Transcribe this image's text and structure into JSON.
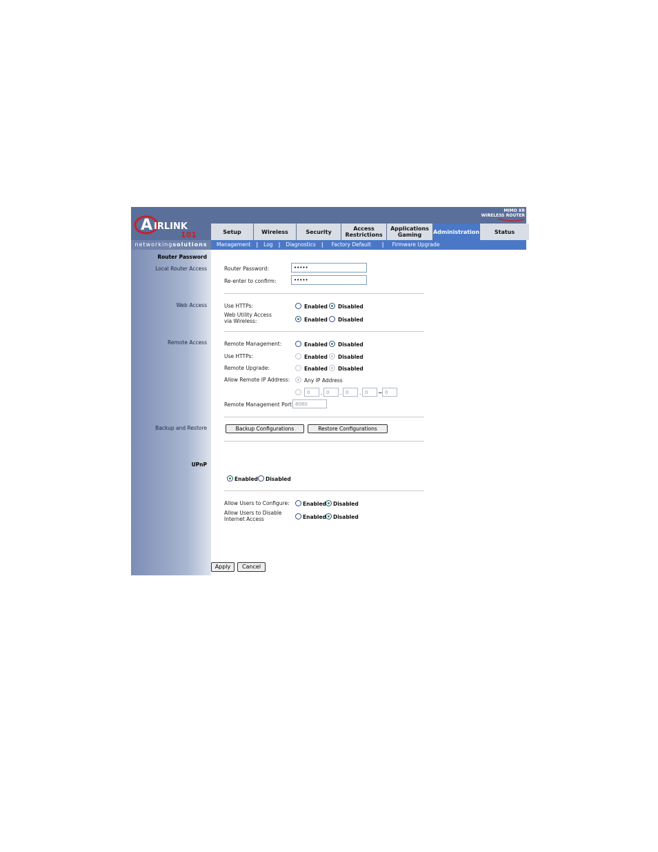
{
  "brand": {
    "logo_text": "AIRLINK 101",
    "tagline_a": "networking",
    "tagline_b": "solutions",
    "product_line1": "MIMO XR",
    "product_line2": "WIRELESS ROUTER"
  },
  "tabs": [
    {
      "label": "Setup"
    },
    {
      "label": "Wireless"
    },
    {
      "label": "Security"
    },
    {
      "label": "Access Restrictions"
    },
    {
      "label": "Applications Gaming"
    },
    {
      "label": "Administration"
    },
    {
      "label": "Status"
    }
  ],
  "subnav": [
    "Management",
    "Log",
    "Diagnostics",
    "Factory Default",
    "Firmware Upgrade"
  ],
  "sidebar": {
    "router_password": "Router Password",
    "local_router_access": "Local Router Access",
    "web_access": "Web Access",
    "remote_access": "Remote Access",
    "backup_restore": "Backup and Restore",
    "upnp": "UPnP"
  },
  "local": {
    "password_label": "Router Password:",
    "password_value": "•••••",
    "confirm_label": "Re-enter to confirm:",
    "confirm_value": "•••••"
  },
  "web": {
    "https_label": "Use HTTPs:",
    "wireless_label": "Web Utility Access via Wireless:"
  },
  "remote": {
    "mgmt_label": "Remote Management:",
    "https_label": "Use HTTPs:",
    "upgrade_label": "Remote Upgrade:",
    "allow_ip_label": "Allow Remote IP Address:",
    "any_ip": "Any IP Address",
    "ip": [
      "0",
      "0",
      "0",
      "0",
      "0"
    ],
    "port_label": "Remote Management Port:",
    "port_value": "8080"
  },
  "radio": {
    "enabled": "Enabled",
    "disabled": "Disabled"
  },
  "backup": {
    "backup_button": "Backup Configurations",
    "restore_button": "Restore Configurations"
  },
  "upnp": {
    "allow_config_label": "Allow Users to Configure:",
    "allow_disable_label": "Allow Users to Disable Internet Access"
  },
  "footer": {
    "apply": "Apply",
    "cancel": "Cancel"
  }
}
